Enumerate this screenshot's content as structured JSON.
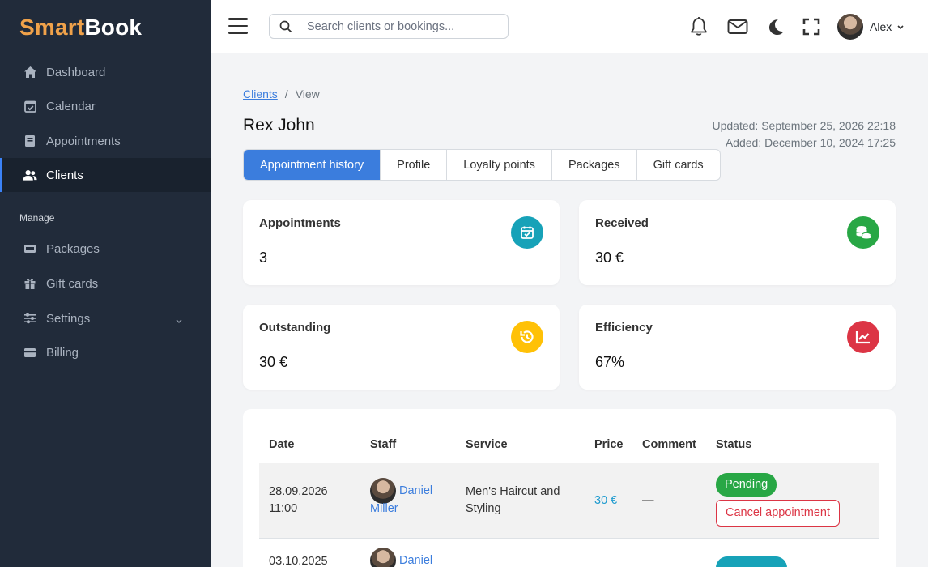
{
  "brand": {
    "part1": "Smart",
    "part2": "Book"
  },
  "sidebar": {
    "items": [
      {
        "label": "Dashboard",
        "icon": "home-icon"
      },
      {
        "label": "Calendar",
        "icon": "calendar-check-icon"
      },
      {
        "label": "Appointments",
        "icon": "book-icon"
      },
      {
        "label": "Clients",
        "icon": "users-icon",
        "active": true
      }
    ],
    "section_label": "Manage",
    "manage_items": [
      {
        "label": "Packages",
        "icon": "package-icon"
      },
      {
        "label": "Gift cards",
        "icon": "gift-icon"
      },
      {
        "label": "Settings",
        "icon": "sliders-icon"
      },
      {
        "label": "Billing",
        "icon": "credit-card-icon"
      }
    ]
  },
  "header": {
    "search_placeholder": "Search clients or bookings...",
    "user_name": "Alex"
  },
  "breadcrumb": {
    "link": "Clients",
    "current": "View"
  },
  "page": {
    "title": "Rex John",
    "updated": "Updated: September 25, 2026 22:18",
    "added": "Added: December 10, 2024 17:25"
  },
  "tabs": [
    "Appointment history",
    "Profile",
    "Loyalty points",
    "Packages",
    "Gift cards"
  ],
  "cards": {
    "appointments": {
      "label": "Appointments",
      "value": "3",
      "color": "#17a2b8"
    },
    "received": {
      "label": "Received",
      "value": "30 €",
      "color": "#28a745"
    },
    "outstanding": {
      "label": "Outstanding",
      "value": "30 €",
      "color": "#ffc107"
    },
    "efficiency": {
      "label": "Efficiency",
      "value": "67%",
      "color": "#dc3545"
    }
  },
  "table": {
    "headers": [
      "Date",
      "Staff",
      "Service",
      "Price",
      "Comment",
      "Status"
    ],
    "rows": [
      {
        "date": "28.09.2026",
        "time": "11:00",
        "staff_first": "Daniel",
        "staff_last": "Miller",
        "service_line1": "Men's Haircut and",
        "service_line2": "Styling",
        "price": "30 €",
        "comment": "—",
        "status": "Pending",
        "action": "Cancel appointment"
      },
      {
        "date": "03.10.2025",
        "staff_first": "Daniel"
      }
    ]
  }
}
